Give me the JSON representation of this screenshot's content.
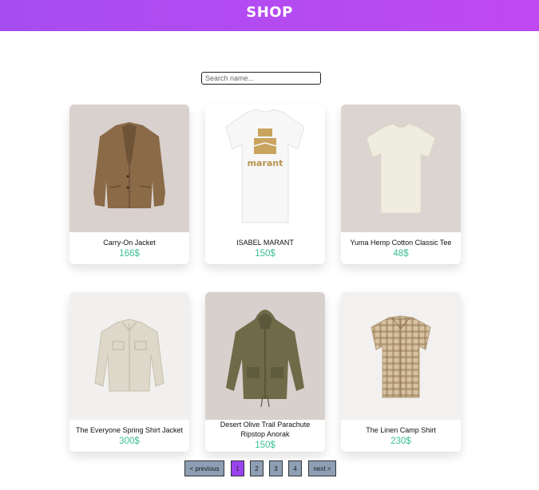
{
  "header": {
    "title": "SHOP"
  },
  "search": {
    "placeholder": "Search name..."
  },
  "products": [
    {
      "name": "Carry-On Jacket",
      "price": "166$"
    },
    {
      "name": "ISABEL MARANT",
      "price": "150$",
      "print_text": "marant"
    },
    {
      "name": "Yuma Hemp Cotton Classic Tee",
      "price": "48$"
    },
    {
      "name": "The Everyone Spring Shirt Jacket",
      "price": "300$"
    },
    {
      "name": "Desert Olive Trail Parachute Ripstop Anorak",
      "price": "150$"
    },
    {
      "name": "The Linen Camp Shirt",
      "price": "230$"
    }
  ],
  "pagination": {
    "previous": "< previous",
    "pages": [
      "1",
      "2",
      "3",
      "4"
    ],
    "current": "1",
    "next": "next >"
  },
  "colors": {
    "header_start": "#a64df0",
    "header_end": "#c049f2",
    "price": "#3bbf95",
    "pager_bg": "#8e9fb5",
    "pager_active": "#9a44f0"
  }
}
